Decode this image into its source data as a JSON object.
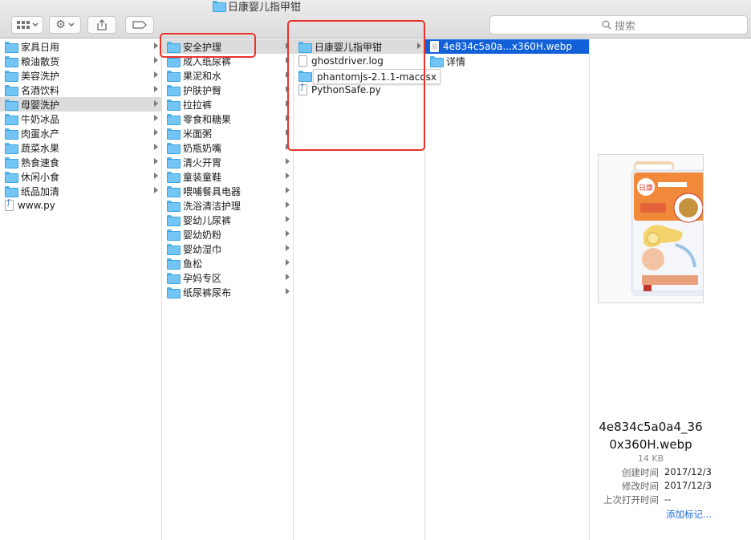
{
  "window": {
    "title": "日康婴儿指甲钳"
  },
  "search": {
    "placeholder": "搜索"
  },
  "column1": {
    "items": [
      {
        "label": "家具日用",
        "kind": "folder"
      },
      {
        "label": "粮油散货",
        "kind": "folder"
      },
      {
        "label": "美容洗护",
        "kind": "folder"
      },
      {
        "label": "名酒饮料",
        "kind": "folder"
      },
      {
        "label": "母婴洗护",
        "kind": "folder",
        "selected": "gray"
      },
      {
        "label": "牛奶冰品",
        "kind": "folder"
      },
      {
        "label": "肉蛋水产",
        "kind": "folder"
      },
      {
        "label": "蔬菜水果",
        "kind": "folder"
      },
      {
        "label": "熟食速食",
        "kind": "folder"
      },
      {
        "label": "休闲小食",
        "kind": "folder"
      },
      {
        "label": "纸品加清",
        "kind": "folder"
      },
      {
        "label": "www.py",
        "kind": "py"
      }
    ]
  },
  "column2": {
    "items": [
      {
        "label": "安全护理",
        "kind": "folder",
        "selected": "gray"
      },
      {
        "label": "成人纸尿裤",
        "kind": "folder"
      },
      {
        "label": "果泥和水",
        "kind": "folder"
      },
      {
        "label": "护肤护臀",
        "kind": "folder"
      },
      {
        "label": "拉拉裤",
        "kind": "folder"
      },
      {
        "label": "零食和糖果",
        "kind": "folder"
      },
      {
        "label": "米面粥",
        "kind": "folder"
      },
      {
        "label": "奶瓶奶嘴",
        "kind": "folder"
      },
      {
        "label": "清火开胃",
        "kind": "folder"
      },
      {
        "label": "童装童鞋",
        "kind": "folder"
      },
      {
        "label": "喂哺餐具电器",
        "kind": "folder"
      },
      {
        "label": "洗浴清洁护理",
        "kind": "folder"
      },
      {
        "label": "婴幼儿尿裤",
        "kind": "folder"
      },
      {
        "label": "婴幼奶粉",
        "kind": "folder"
      },
      {
        "label": "婴幼湿巾",
        "kind": "folder"
      },
      {
        "label": "鱼松",
        "kind": "folder"
      },
      {
        "label": "孕妈专区",
        "kind": "folder"
      },
      {
        "label": "纸尿裤尿布",
        "kind": "folder"
      }
    ]
  },
  "column3": {
    "items": [
      {
        "label": "日康婴儿指甲钳",
        "kind": "folder",
        "selected": "gray"
      },
      {
        "label": "ghostdriver.log",
        "kind": "doc"
      },
      {
        "label": "phantomjs-2.1.1-macosx",
        "kind": "folder"
      },
      {
        "label": "PythonSafe.py",
        "kind": "py"
      }
    ]
  },
  "column4": {
    "items": [
      {
        "label": "4e834c5a0a...x360H.webp",
        "kind": "img",
        "selected": "blue"
      },
      {
        "label": "详情",
        "kind": "folder"
      }
    ]
  },
  "preview": {
    "filename": "4e834c5a0a4_360x360H.webp",
    "size": "14 KB",
    "meta": [
      {
        "key": "创建时间",
        "value": "2017/12/3"
      },
      {
        "key": "修改时间",
        "value": "2017/12/3"
      },
      {
        "key": "上次打开时间",
        "value": "--"
      }
    ],
    "add_tags": "添加标记...",
    "package_text": "日康婴儿指甲钳"
  },
  "colors": {
    "selection_blue": "#1160d8",
    "annotation_red": "#e8332b",
    "folder_blue": "#72c5f4"
  }
}
